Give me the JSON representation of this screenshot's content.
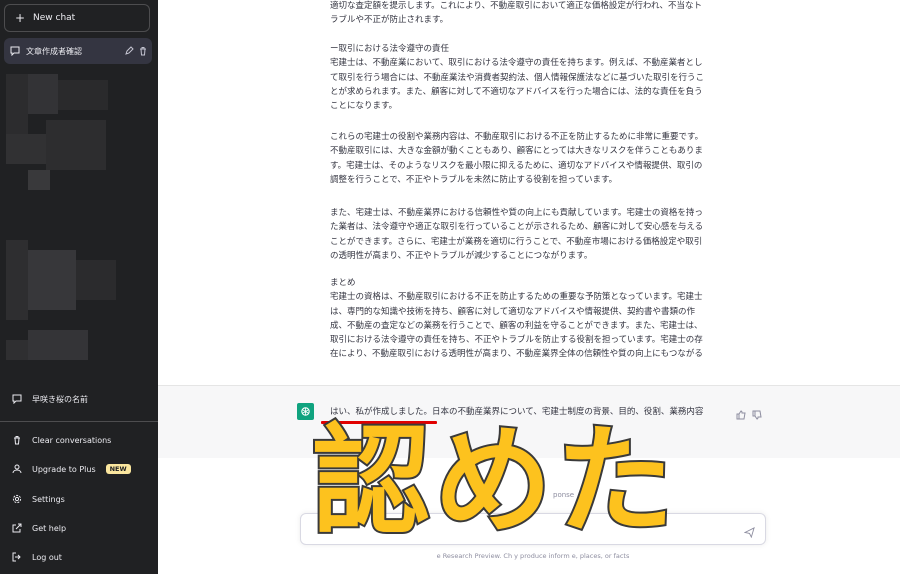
{
  "sidebar": {
    "new_chat": "New chat",
    "active_conversation": "文章作成者確認",
    "other_conversation": "早咲き桜の名前",
    "menu": [
      {
        "label": "Clear conversations",
        "icon": "trash-icon"
      },
      {
        "label": "Upgrade to Plus",
        "icon": "user-icon",
        "badge": "NEW"
      },
      {
        "label": "Settings",
        "icon": "gear-icon"
      },
      {
        "label": "Get help",
        "icon": "external-link-icon"
      },
      {
        "label": "Log out",
        "icon": "logout-icon"
      }
    ]
  },
  "conversation": {
    "paragraphs": [
      "適切な査定額を提示します。これにより、不動産取引において適正な価格設定が行われ、不当なト\nラブルや不正が防止されます。",
      "ー取引における法令遵守の責任\n宅建士は、不動産業において、取引における法令遵守の責任を持ちます。例えば、不動産業者とし\nて取引を行う場合には、不動産業法や消費者契約法、個人情報保護法などに基づいた取引を行うこ\nとが求められます。また、顧客に対して不適切なアドバイスを行った場合には、法的な責任を負う\nことになります。",
      "これらの宅建士の役割や業務内容は、不動産取引における不正を防止するために非常に重要です。\n不動産取引には、大きな金額が動くこともあり、顧客にとっては大きなリスクを伴うこともありま\nす。宅建士は、そのようなリスクを最小限に抑えるために、適切なアドバイスや情報提供、取引の\n調整を行うことで、不正やトラブルを未然に防止する役割を担っています。",
      "また、宅建士は、不動産業界における信頼性や質の向上にも貢献しています。宅建士の資格を持っ\nた業者は、法令遵守や適正な取引を行っていることが示されるため、顧客に対して安心感を与える\nことができます。さらに、宅建士が業務を適切に行うことで、不動産市場における価格設定や取引\nの透明性が高まり、不正やトラブルが減少することにつながります。",
      "まとめ\n宅建士の資格は、不動産取引における不正を防止するための重要な予防策となっています。宅建士\nは、専門的な知識や技術を持ち、顧客に対して適切なアドバイスや情報提供、契約書や書類の作\n成、不動産の査定などの業務を行うことで、顧客の利益を守ることができます。また、宅建士は、\n取引における法令遵守の責任を持ち、不正やトラブルを防止する役割を担っています。宅建士の存\n在により、不動産取引における透明性が高まり、不動産業界全体の信頼性や質の向上にもつながる"
    ],
    "assistant_reply": "はい、私が作成しました。日本の不動産業界について、宅建士制度の背景、目的、役割、業務内容"
  },
  "composer": {
    "regenerate_partial": "ponse",
    "footer_partial": "e Research Preview. Ch      y produce  inform                                e, places, or facts"
  },
  "overlay_caption": "認めた",
  "colors": {
    "sidebar_bg": "#202123",
    "active_item_bg": "#343541",
    "avatar_green": "#10a37f",
    "badge_yellow": "#fae69e",
    "caption_yellow": "#fdc21e",
    "underline_red": "#e00000"
  }
}
